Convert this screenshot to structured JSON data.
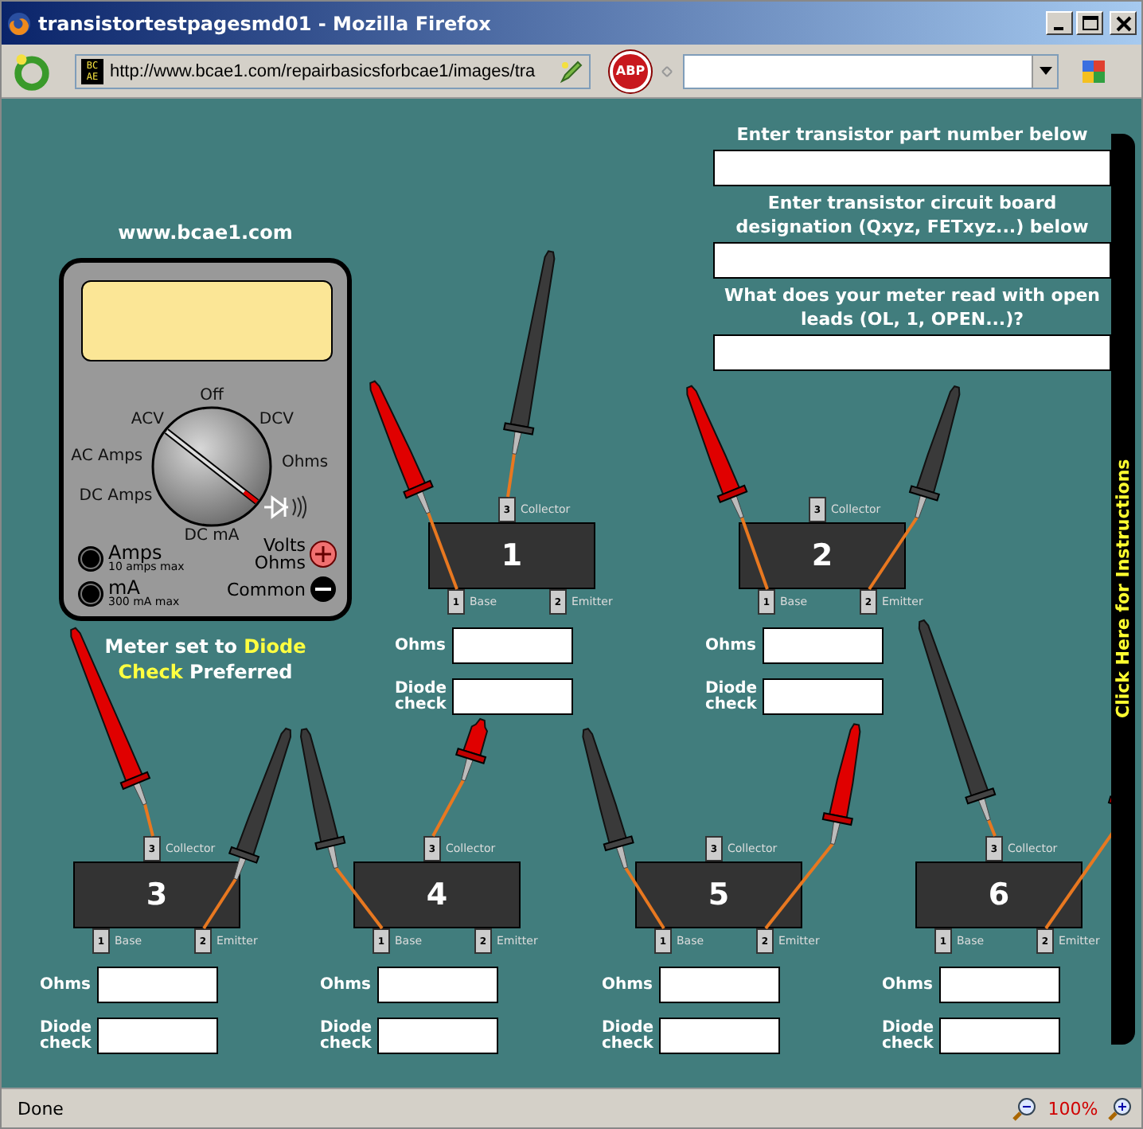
{
  "window": {
    "title": "transistortestpagesmd01 - Mozilla Firefox"
  },
  "toolbar": {
    "site_icon": [
      "BC",
      "AE"
    ],
    "address": "http://www.bcae1.com/repairbasicsforbcae1/images/tra",
    "adblock_label": "ABP"
  },
  "site_link": "www.bcae1.com",
  "meter": {
    "dial": [
      {
        "label": "ACV",
        "selected": false
      },
      {
        "label": "Off",
        "selected": false
      },
      {
        "label": "DCV",
        "selected": false
      },
      {
        "label": "Ohms",
        "selected": false
      },
      {
        "kind": "diode",
        "selected": true
      },
      {
        "label": "DC mA",
        "selected": false
      },
      {
        "label": "DC Amps",
        "selected": false
      },
      {
        "label": "AC Amps",
        "selected": false
      }
    ],
    "jacks": [
      {
        "label": "Amps",
        "note": "10 amps max"
      },
      {
        "label": "mA",
        "note": "300 mA max"
      }
    ],
    "volts_label": [
      "Volts",
      "Ohms"
    ],
    "common_label": "Common"
  },
  "meter_note": [
    {
      "text": "Meter set to ",
      "highlight": false
    },
    {
      "text": "Diode",
      "highlight": true
    },
    {
      "text": "Check",
      "highlight": true
    },
    {
      "text": " Preferred",
      "highlight": false
    }
  ],
  "questions": [
    {
      "label": "Enter transistor part number below"
    },
    {
      "label": "Enter transistor circuit board designation (Qxyz, FETxyz...) below"
    },
    {
      "label": "What does your meter read with open leads (OL, 1, OPEN...)?"
    }
  ],
  "transistors": [
    {
      "number": "1",
      "pins": [
        {
          "kind": "collector",
          "num": "3",
          "name": "Collector",
          "red_probe": false,
          "black_probe": true
        },
        {
          "kind": "base",
          "num": "1",
          "name": "Base",
          "red_probe": true,
          "black_probe": false
        },
        {
          "kind": "emitter",
          "num": "2",
          "name": "Emitter",
          "red_probe": false,
          "black_probe": false
        }
      ],
      "fields": [
        "Ohms",
        "Diode check"
      ]
    },
    {
      "number": "2",
      "pins": [
        {
          "kind": "collector",
          "num": "3",
          "name": "Collector",
          "red_probe": false,
          "black_probe": false
        },
        {
          "kind": "base",
          "num": "1",
          "name": "Base",
          "red_probe": true,
          "black_probe": false
        },
        {
          "kind": "emitter",
          "num": "2",
          "name": "Emitter",
          "red_probe": false,
          "black_probe": true
        }
      ],
      "fields": [
        "Ohms",
        "Diode check"
      ]
    },
    {
      "number": "3",
      "pins": [
        {
          "kind": "collector",
          "num": "3",
          "name": "Collector",
          "red_probe": true,
          "black_probe": false
        },
        {
          "kind": "base",
          "num": "1",
          "name": "Base",
          "red_probe": false,
          "black_probe": false
        },
        {
          "kind": "emitter",
          "num": "2",
          "name": "Emitter",
          "red_probe": false,
          "black_probe": true
        }
      ],
      "fields": [
        "Ohms",
        "Diode check"
      ]
    },
    {
      "number": "4",
      "pins": [
        {
          "kind": "collector",
          "num": "3",
          "name": "Collector",
          "red_probe": true,
          "black_probe": false
        },
        {
          "kind": "base",
          "num": "1",
          "name": "Base",
          "red_probe": false,
          "black_probe": true
        },
        {
          "kind": "emitter",
          "num": "2",
          "name": "Emitter",
          "red_probe": false,
          "black_probe": false
        }
      ],
      "fields": [
        "Ohms",
        "Diode check"
      ]
    },
    {
      "number": "5",
      "pins": [
        {
          "kind": "collector",
          "num": "3",
          "name": "Collector",
          "red_probe": false,
          "black_probe": false
        },
        {
          "kind": "base",
          "num": "1",
          "name": "Base",
          "red_probe": false,
          "black_probe": true
        },
        {
          "kind": "emitter",
          "num": "2",
          "name": "Emitter",
          "red_probe": true,
          "black_probe": false
        }
      ],
      "fields": [
        "Ohms",
        "Diode check"
      ]
    },
    {
      "number": "6",
      "pins": [
        {
          "kind": "collector",
          "num": "3",
          "name": "Collector",
          "red_probe": false,
          "black_probe": true
        },
        {
          "kind": "base",
          "num": "1",
          "name": "Base",
          "red_probe": false,
          "black_probe": false
        },
        {
          "kind": "emitter",
          "num": "2",
          "name": "Emitter",
          "red_probe": true,
          "black_probe": false
        }
      ],
      "fields": [
        "Ohms",
        "Diode check"
      ]
    }
  ],
  "instructions_button": "Click Here for Instructions",
  "status_bar": {
    "text": "Done",
    "zoom": "100%"
  }
}
